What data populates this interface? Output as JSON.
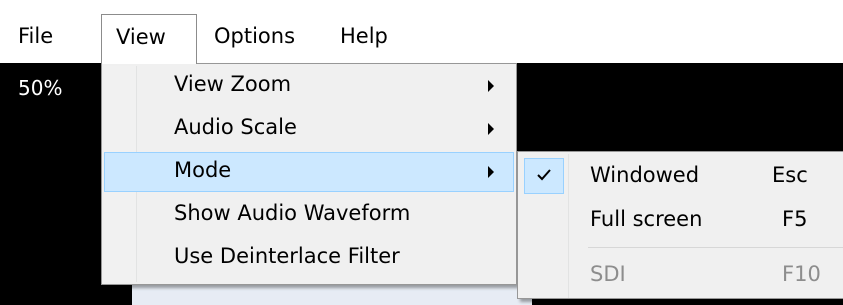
{
  "menubar": {
    "items": [
      {
        "label": "File"
      },
      {
        "label": "View"
      },
      {
        "label": "Options"
      },
      {
        "label": "Help"
      }
    ]
  },
  "video": {
    "zoom_readout": "50%"
  },
  "view_menu": {
    "items": [
      {
        "label": "View Zoom",
        "has_submenu": true
      },
      {
        "label": "Audio Scale",
        "has_submenu": true
      },
      {
        "label": "Mode",
        "has_submenu": true,
        "highlighted": true
      },
      {
        "label": "Show Audio Waveform"
      },
      {
        "label": "Use Deinterlace Filter"
      }
    ]
  },
  "mode_submenu": {
    "items": [
      {
        "label": "Windowed",
        "shortcut": "Esc",
        "checked": true
      },
      {
        "label": "Full screen",
        "shortcut": "F5"
      },
      {
        "label": "SDI",
        "shortcut": "F10",
        "disabled": true
      }
    ]
  },
  "colors": {
    "highlight_bg": "#cce8ff",
    "highlight_border": "#99d1ff",
    "menu_bg": "#f0f0f0",
    "disabled_text": "#8d8d8d",
    "video_bg": "#000000"
  }
}
